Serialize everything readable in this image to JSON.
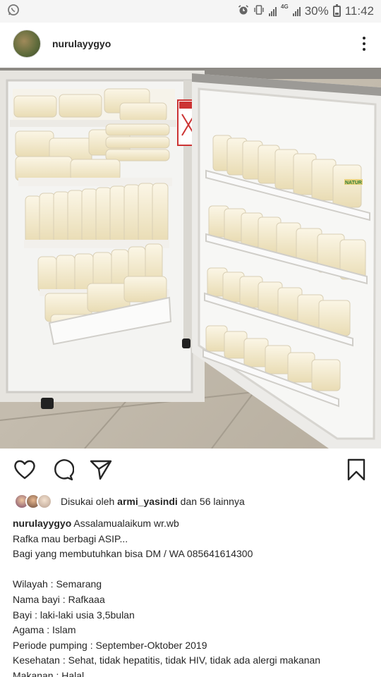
{
  "status_bar": {
    "app_notification_icon": "whatsapp-icon",
    "network_label": "4G",
    "battery_percent": "30%",
    "time": "11:42"
  },
  "post": {
    "username": "nurulayygyo",
    "photo_icon": "photo",
    "liked_by_prefix": "Disukai oleh",
    "liked_by_user": "armi_yasindi",
    "liked_by_suffix": "dan 56 lainnya",
    "caption_author": "nurulayygyo",
    "caption_lines": [
      "Assalamualaikum wr.wb",
      "Rafka mau berbagi ASIP...",
      "Bagi yang membutuhkan bisa DM / WA 085641614300",
      "",
      "Wilayah : Semarang",
      "Nama bayi : Rafkaaa",
      "Bayi : laki-laki usia 3,5bulan",
      "Agama : Islam",
      "Periode pumping : September-Oktober 2019",
      "Kesehatan : Sehat, tidak hepatitis, tidak HIV, tidak ada alergi makanan",
      "Makanan : Halal"
    ]
  },
  "photo_labels": {
    "bag_brand": "NATUR"
  }
}
